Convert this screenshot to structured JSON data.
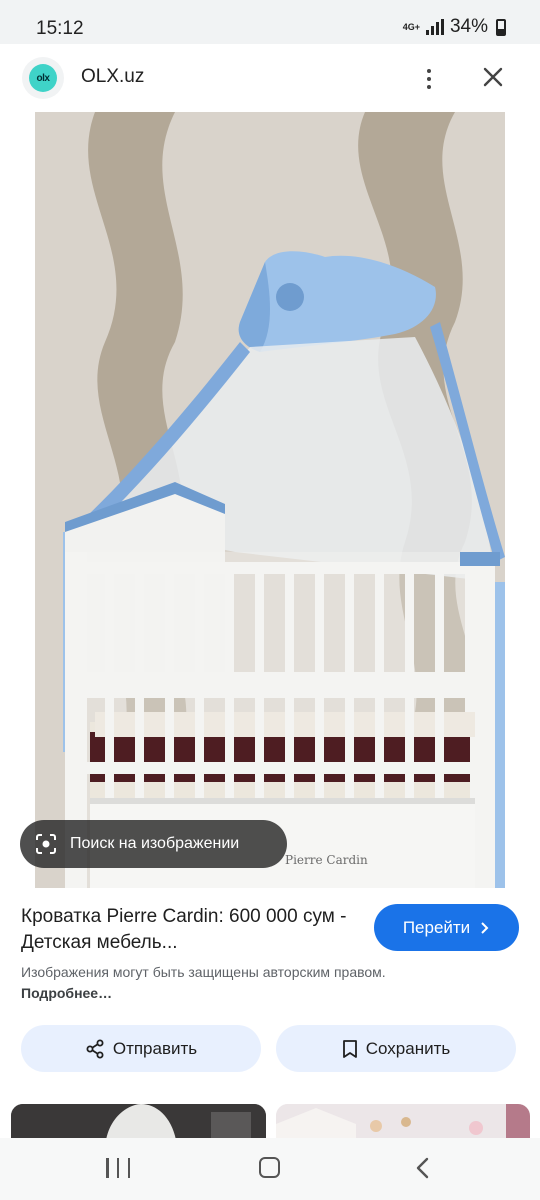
{
  "status_bar": {
    "time": "15:12",
    "network": "4G+",
    "battery": "34%"
  },
  "header": {
    "site_name": "OLX.uz",
    "logo_text": "olx"
  },
  "image": {
    "lens_label": "Поиск на изображении",
    "overlay_text": "Pierre Cardin"
  },
  "result": {
    "title": "Кроватка Pierre Cardin: 600 000 сум - Детская мебель...",
    "visit_label": "Перейти",
    "copyright_text": "Изображения могут быть защищены авторским правом.",
    "more_link": "Подробнее…"
  },
  "actions": {
    "share_label": "Отправить",
    "save_label": "Сохранить"
  },
  "colors": {
    "accent": "#1a73e8",
    "chip_bg": "#e8f0fe",
    "olx_teal": "#3fd3c8"
  }
}
